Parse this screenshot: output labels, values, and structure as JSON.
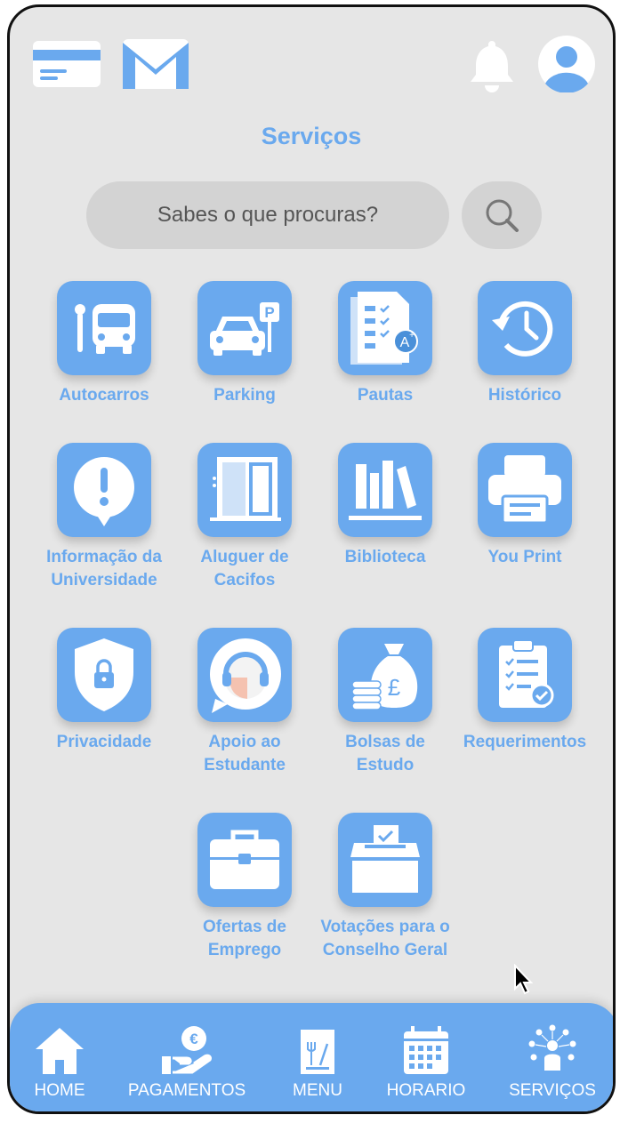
{
  "header": {
    "title": "Serviços",
    "icons": [
      "card-icon",
      "mail-icon",
      "bell-icon",
      "avatar-icon"
    ]
  },
  "search": {
    "placeholder": "Sabes o que procuras?",
    "button_icon": "search-icon"
  },
  "services": [
    {
      "label": "Autocarros",
      "icon": "bus-icon"
    },
    {
      "label": "Parking",
      "icon": "car-parking-icon"
    },
    {
      "label": "Pautas",
      "icon": "grades-checklist-icon"
    },
    {
      "label": "Histórico",
      "icon": "history-clock-icon"
    },
    {
      "label": "Informação da Universidade",
      "icon": "info-exclamation-icon"
    },
    {
      "label": "Aluguer de Cacifos",
      "icon": "lockers-icon"
    },
    {
      "label": "Biblioteca",
      "icon": "books-icon"
    },
    {
      "label": "You Print",
      "icon": "printer-icon"
    },
    {
      "label": "Privacidade",
      "icon": "shield-lock-icon"
    },
    {
      "label": "Apoio ao Estudante",
      "icon": "support-headset-icon"
    },
    {
      "label": "Bolsas de Estudo",
      "icon": "money-bag-icon"
    },
    {
      "label": "Requerimentos",
      "icon": "clipboard-check-icon"
    },
    {
      "label": "Ofertas de Emprego",
      "icon": "briefcase-icon"
    },
    {
      "label": "Votações para o Conselho Geral",
      "icon": "ballot-box-icon"
    }
  ],
  "nav": [
    {
      "label": "HOME",
      "icon": "home-icon"
    },
    {
      "label": "PAGAMENTOS",
      "icon": "payments-euro-icon"
    },
    {
      "label": "MENU",
      "icon": "menu-food-icon"
    },
    {
      "label": "HORARIO",
      "icon": "calendar-icon"
    },
    {
      "label": "SERVIÇOS",
      "icon": "services-people-icon"
    }
  ],
  "colors": {
    "accent": "#6aa9ee",
    "background": "#e6e6e6",
    "search_bg": "#d3d3d3"
  }
}
